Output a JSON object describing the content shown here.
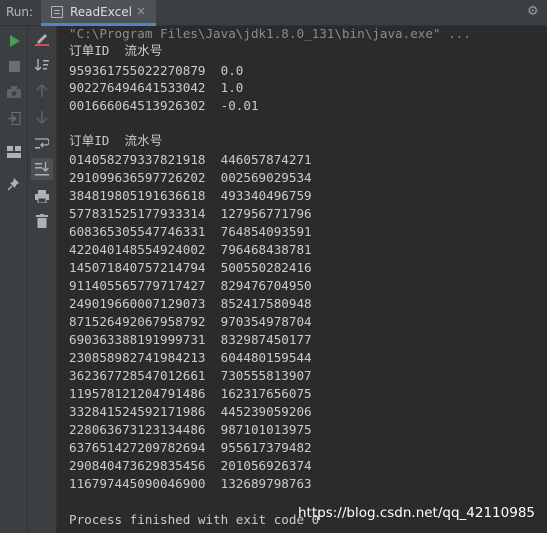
{
  "header": {
    "run_label": "Run:",
    "tab_label": "ReadExcel",
    "tab_close": "×"
  },
  "console": {
    "command": "\"C:\\Program Files\\Java\\jdk1.8.0_131\\bin\\java.exe\" ...",
    "section1_header": "订单ID  流水号",
    "section1_rows": [
      "959361755022270879  0.0",
      "902276494641533042  1.0",
      "001666064513926302  -0.01"
    ],
    "section2_header": "订单ID  流水号",
    "section2_rows": [
      "014058279337821918  446057874271",
      "291099636597726202  002569029534",
      "384819805191636618  493340496759",
      "577831525177933314  127956771796",
      "608365305547746331  764854093591",
      "422040148554924002  796468438781",
      "145071840757214794  500550282416",
      "911405565779717427  829476704950",
      "249019660007129073  852417580948",
      "871526492067958792  970354978704",
      "690363388191999731  832987450177",
      "230858982741984213  604480159544",
      "362367728547012661  730555813907",
      "119578121204791486  162317656075",
      "332841524592171986  445239059206",
      "228063673123134486  987101013975",
      "637651427209782694  955617379482",
      "290840473629835456  201056926374",
      "116797445090046900  132689798763"
    ],
    "exit_message": "Process finished with exit code 0"
  },
  "watermark": "https://blog.csdn.net/qq_42110985",
  "colors": {
    "run_green": "#499c54",
    "stop_gray": "#6e6e6e",
    "close_red": "#c75450",
    "accent_blue": "#4a88c7"
  }
}
